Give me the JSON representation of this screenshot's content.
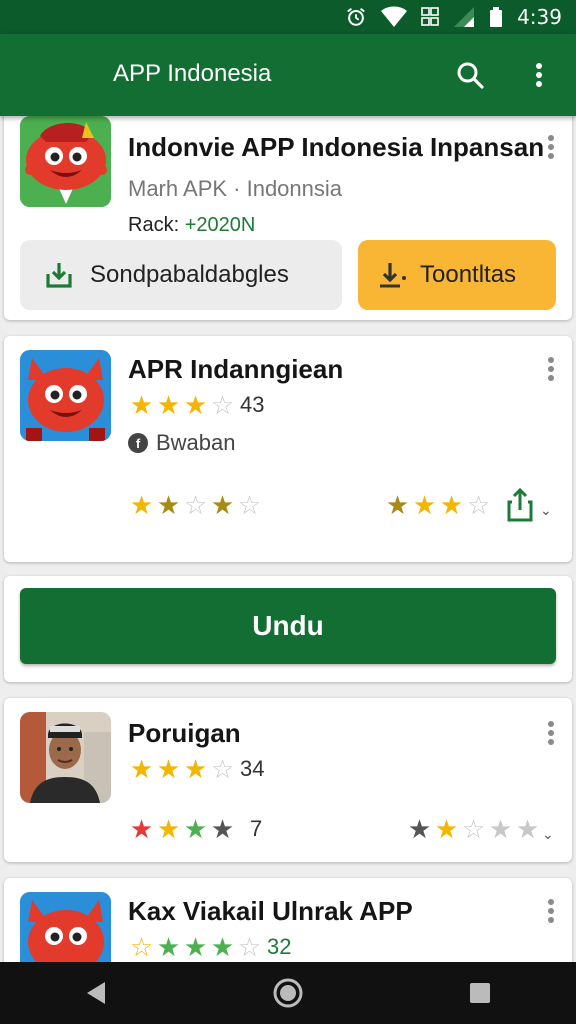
{
  "status_bar": {
    "time": "4:39"
  },
  "app_bar": {
    "title": "APP Indonesia"
  },
  "cards": [
    {
      "title": "Indonvie APP Indonesia Inpansan",
      "subtitle": "Marh APK · Indonnsia",
      "rank_label": "Rack:",
      "rank_value": "+2020N",
      "install_label": "Sondpabaldabgles",
      "open_label": "Toontltas"
    },
    {
      "title": "APR Indanngiean",
      "rating": "43",
      "developer": "Bwaban"
    },
    {
      "button_label": "Undu"
    },
    {
      "title": "Poruigan",
      "rating": "34",
      "second_rating": "7"
    },
    {
      "title": "Kax Viakail Ulnrak APP",
      "rating": "32"
    }
  ],
  "colors": {
    "primary": "#136e33",
    "status_bar": "#0b5b2b",
    "accent": "#f9b534",
    "star": "#f2b705"
  }
}
